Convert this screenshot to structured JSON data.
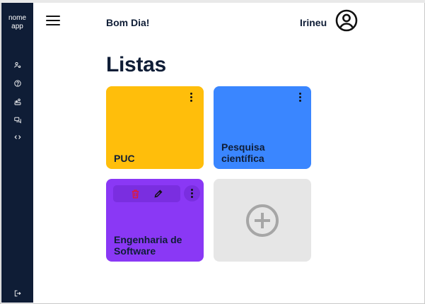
{
  "colors": {
    "sidebar_bg": "#0f1d36",
    "text_dark": "#0f1d36",
    "card_yellow": "#ffbe0b",
    "card_blue": "#3a86ff",
    "card_purple": "#8a38f5",
    "card_add": "#e6e6e6",
    "action_bar": "#7a2ee0",
    "delete_red": "#e0193a"
  },
  "sidebar": {
    "app_name_line1": "nome",
    "app_name_line2": "app",
    "items": [
      {
        "icon": "users-settings-icon"
      },
      {
        "icon": "help-circle-icon"
      },
      {
        "icon": "people-transfer-icon"
      },
      {
        "icon": "chat-icon"
      },
      {
        "icon": "code-icon"
      }
    ],
    "logout_icon": "logout-icon"
  },
  "header": {
    "greeting": "Bom Dia!",
    "username": "Irineu",
    "menu_icon": "hamburger-icon",
    "profile_icon": "user-circle-icon"
  },
  "main": {
    "title": "Listas",
    "cards": [
      {
        "title": "PUC",
        "color": "yellow"
      },
      {
        "title_line1": "Pesquisa",
        "title_line2": "científica",
        "color": "blue"
      },
      {
        "title_line1": "Engenharia de",
        "title_line2": "Software",
        "color": "purple",
        "actions": [
          "delete-icon",
          "edit-icon"
        ]
      }
    ],
    "add_card_icon": "plus-circle-icon"
  }
}
